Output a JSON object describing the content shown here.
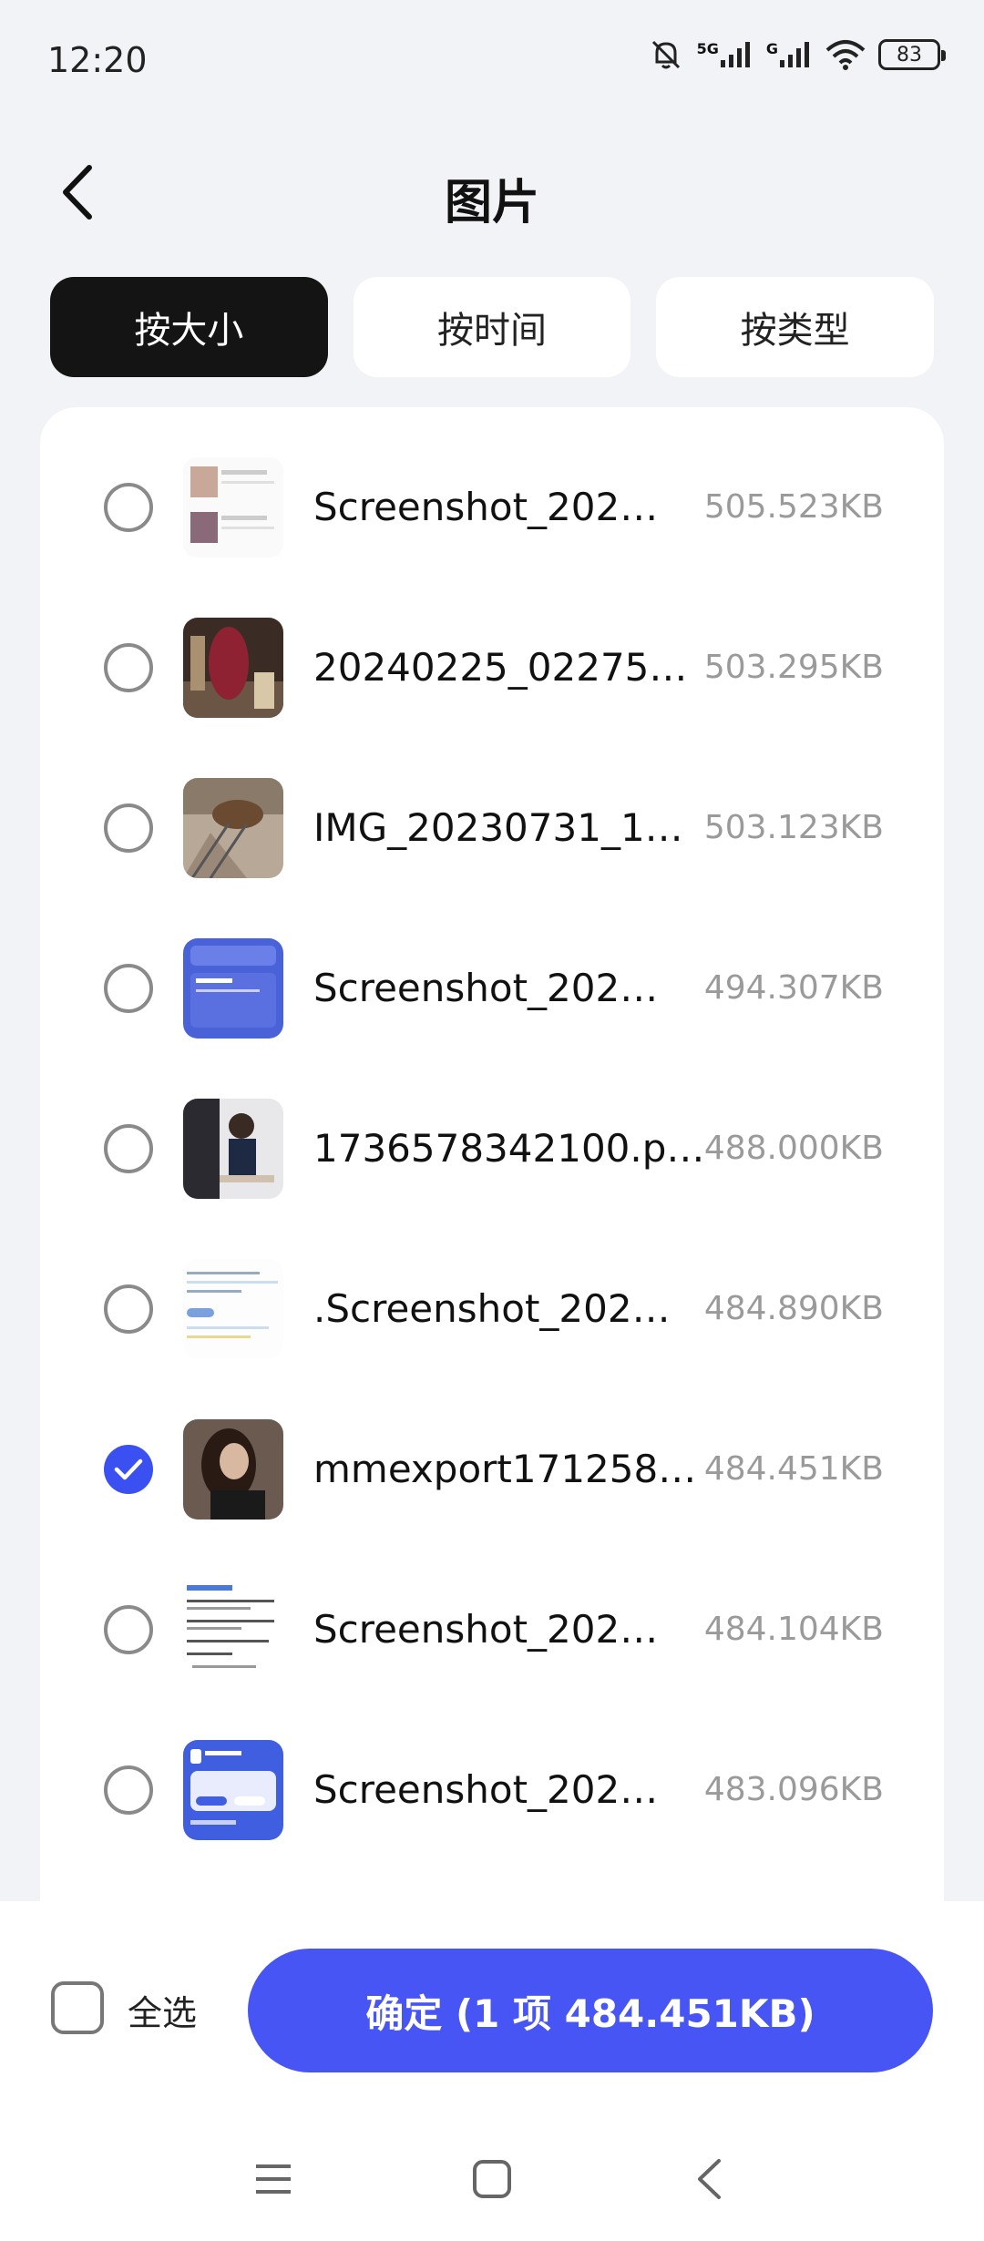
{
  "status_bar": {
    "time": "12:20",
    "network_1": "5G",
    "network_2": "G",
    "battery": "83"
  },
  "header": {
    "title": "图片"
  },
  "tabs": [
    {
      "label": "按大小",
      "active": true
    },
    {
      "label": "按时间",
      "active": false
    },
    {
      "label": "按类型",
      "active": false
    }
  ],
  "files": [
    {
      "name": "Screenshot_202…",
      "size": "505.523KB",
      "checked": false,
      "thumb": "screenshot-light"
    },
    {
      "name": "20240225_02275…",
      "size": "503.295KB",
      "checked": false,
      "thumb": "photo-red"
    },
    {
      "name": "IMG_20230731_1…",
      "size": "503.123KB",
      "checked": false,
      "thumb": "photo-street"
    },
    {
      "name": "Screenshot_202…",
      "size": "494.307KB",
      "checked": false,
      "thumb": "screenshot-blue"
    },
    {
      "name": "1736578342100.p…",
      "size": "488.000KB",
      "checked": false,
      "thumb": "photo-office"
    },
    {
      "name": ".Screenshot_202…",
      "size": "484.890KB",
      "checked": false,
      "thumb": "screenshot-text"
    },
    {
      "name": "mmexport171258…",
      "size": "484.451KB",
      "checked": true,
      "thumb": "photo-portrait"
    },
    {
      "name": "Screenshot_202…",
      "size": "484.104KB",
      "checked": false,
      "thumb": "screenshot-doc"
    },
    {
      "name": "Screenshot_202…",
      "size": "483.096KB",
      "checked": false,
      "thumb": "screenshot-blue2"
    }
  ],
  "footer": {
    "select_all_label": "全选",
    "confirm_label": "确定 (1 项 484.451KB)"
  },
  "colors": {
    "accent": "#4755f4",
    "checked": "#3b50f0",
    "active_tab": "#141414"
  }
}
